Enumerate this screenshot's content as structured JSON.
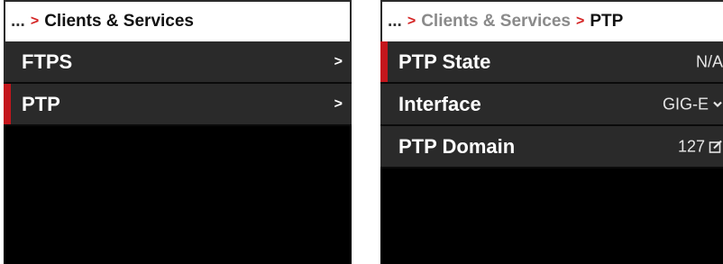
{
  "left_panel": {
    "breadcrumb": {
      "ellipsis": "...",
      "separator": ">",
      "current": "Clients & Services"
    },
    "items": [
      {
        "label": "FTPS",
        "selected": false,
        "chevron": ">"
      },
      {
        "label": "PTP",
        "selected": true,
        "chevron": ">"
      }
    ]
  },
  "right_panel": {
    "breadcrumb": {
      "ellipsis": "...",
      "separator": ">",
      "parent": "Clients & Services",
      "separator2": ">",
      "current": "PTP"
    },
    "items": [
      {
        "label": "PTP State",
        "value": "N/A",
        "selected": true,
        "icon": ""
      },
      {
        "label": "Interface",
        "value": "GIG-E",
        "selected": false,
        "icon": "chevron-down-icon"
      },
      {
        "label": "PTP Domain",
        "value": "127",
        "selected": false,
        "icon": "edit-icon"
      }
    ]
  },
  "colors": {
    "accent": "#c4161c",
    "row_bg": "#2a2a2a",
    "screen_bg": "#000000"
  }
}
